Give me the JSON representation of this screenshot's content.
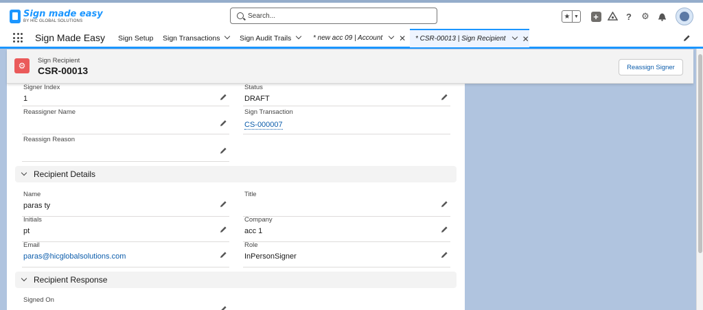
{
  "header": {
    "logo_title": "Sign made easy",
    "logo_subtitle": "BY HIC GLOBAL SOLUTIONS",
    "search_placeholder": "Search..."
  },
  "nav": {
    "app_name": "Sign Made Easy",
    "items": [
      {
        "label": "Sign Setup"
      },
      {
        "label": "Sign Transactions"
      },
      {
        "label": "Sign Audit Trails"
      }
    ],
    "tabs": [
      {
        "label": "* new acc 09 | Account",
        "active": false
      },
      {
        "label": "* CSR-00013 | Sign Recipient",
        "active": true
      }
    ]
  },
  "record": {
    "object_type": "Sign Recipient",
    "name": "CSR-00013",
    "action_button": "Reassign Signer"
  },
  "fields_top": {
    "signer_index": {
      "label": "Signer Index",
      "value": "1"
    },
    "status": {
      "label": "Status",
      "value": "DRAFT"
    },
    "reassigner_name": {
      "label": "Reassigner Name",
      "value": ""
    },
    "sign_transaction": {
      "label": "Sign Transaction",
      "value": "CS-000007"
    },
    "reassign_reason": {
      "label": "Reassign Reason",
      "value": ""
    }
  },
  "sections": {
    "recipient_details": "Recipient Details",
    "recipient_response": "Recipient Response"
  },
  "recipient_details": {
    "name": {
      "label": "Name",
      "value": "paras ty"
    },
    "title": {
      "label": "Title",
      "value": ""
    },
    "initials": {
      "label": "Initials",
      "value": "pt"
    },
    "company": {
      "label": "Company",
      "value": "acc 1"
    },
    "email": {
      "label": "Email",
      "value": "paras@hicglobalsolutions.com"
    },
    "role": {
      "label": "Role",
      "value": "InPersonSigner"
    }
  },
  "recipient_response": {
    "signed_on": {
      "label": "Signed On",
      "value": ""
    }
  },
  "colors": {
    "brand": "#1b96ff",
    "link": "#0b5cab",
    "object_icon": "#ea5a5a",
    "background": "#b0c4df"
  }
}
